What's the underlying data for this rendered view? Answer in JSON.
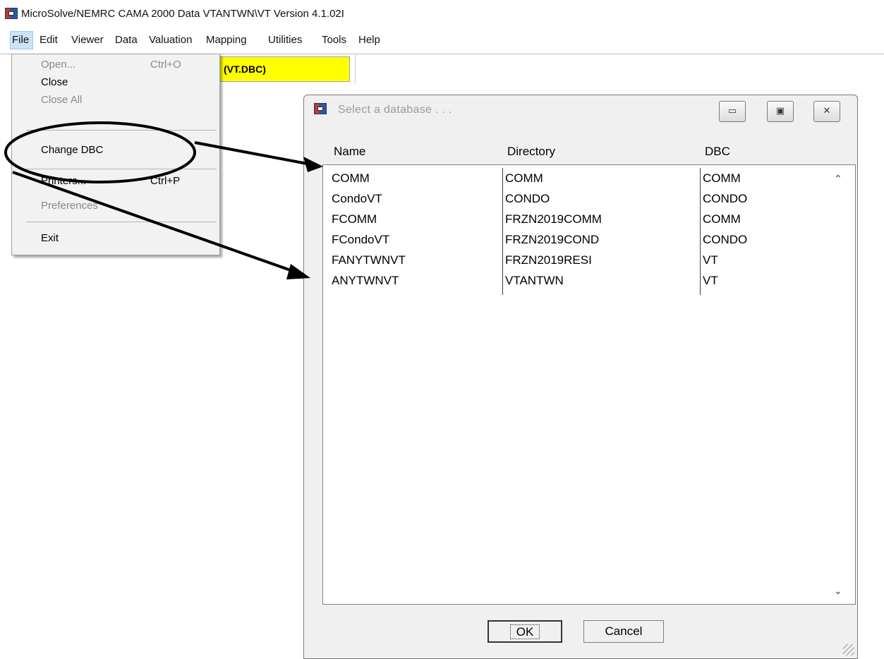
{
  "window": {
    "title": "MicroSolve/NEMRC CAMA 2000  Data VTANTWN\\VT Version 4.1.02I",
    "icon": "app-icon"
  },
  "menubar": {
    "items": [
      "File",
      "Edit",
      "Viewer",
      "Data",
      "Valuation",
      "Mapping",
      "Utilities",
      "Tools",
      "Help"
    ]
  },
  "toolbar": {
    "dbc_label": "(VT.DBC)",
    "dbc_color": "#ffff00"
  },
  "file_menu": {
    "open": "Open...",
    "open_shortcut": "Ctrl+O",
    "close": "Close",
    "close_all": "Close All",
    "change_dbc": "Change DBC",
    "printers": "Printers...",
    "printers_shortcut": "Ctrl+P",
    "preferences": "Preferences",
    "exit": "Exit"
  },
  "dialog": {
    "title": "Select a database . . .",
    "headers": {
      "name": "Name",
      "directory": "Directory",
      "dbc": "DBC"
    },
    "rows": [
      {
        "name": "COMM",
        "directory": "COMM",
        "dbc": "COMM"
      },
      {
        "name": "CondoVT",
        "directory": "CONDO",
        "dbc": "CONDO"
      },
      {
        "name": "FCOMM",
        "directory": "FRZN2019COMM",
        "dbc": "COMM"
      },
      {
        "name": "FCondoVT",
        "directory": "FRZN2019COND",
        "dbc": "CONDO"
      },
      {
        "name": "FANYTWNVT",
        "directory": "FRZN2019RESI",
        "dbc": "VT"
      },
      {
        "name": "ANYTWNVT",
        "directory": "VTANTWN",
        "dbc": "VT"
      }
    ],
    "ok_label": "OK",
    "cancel_label": "Cancel"
  }
}
